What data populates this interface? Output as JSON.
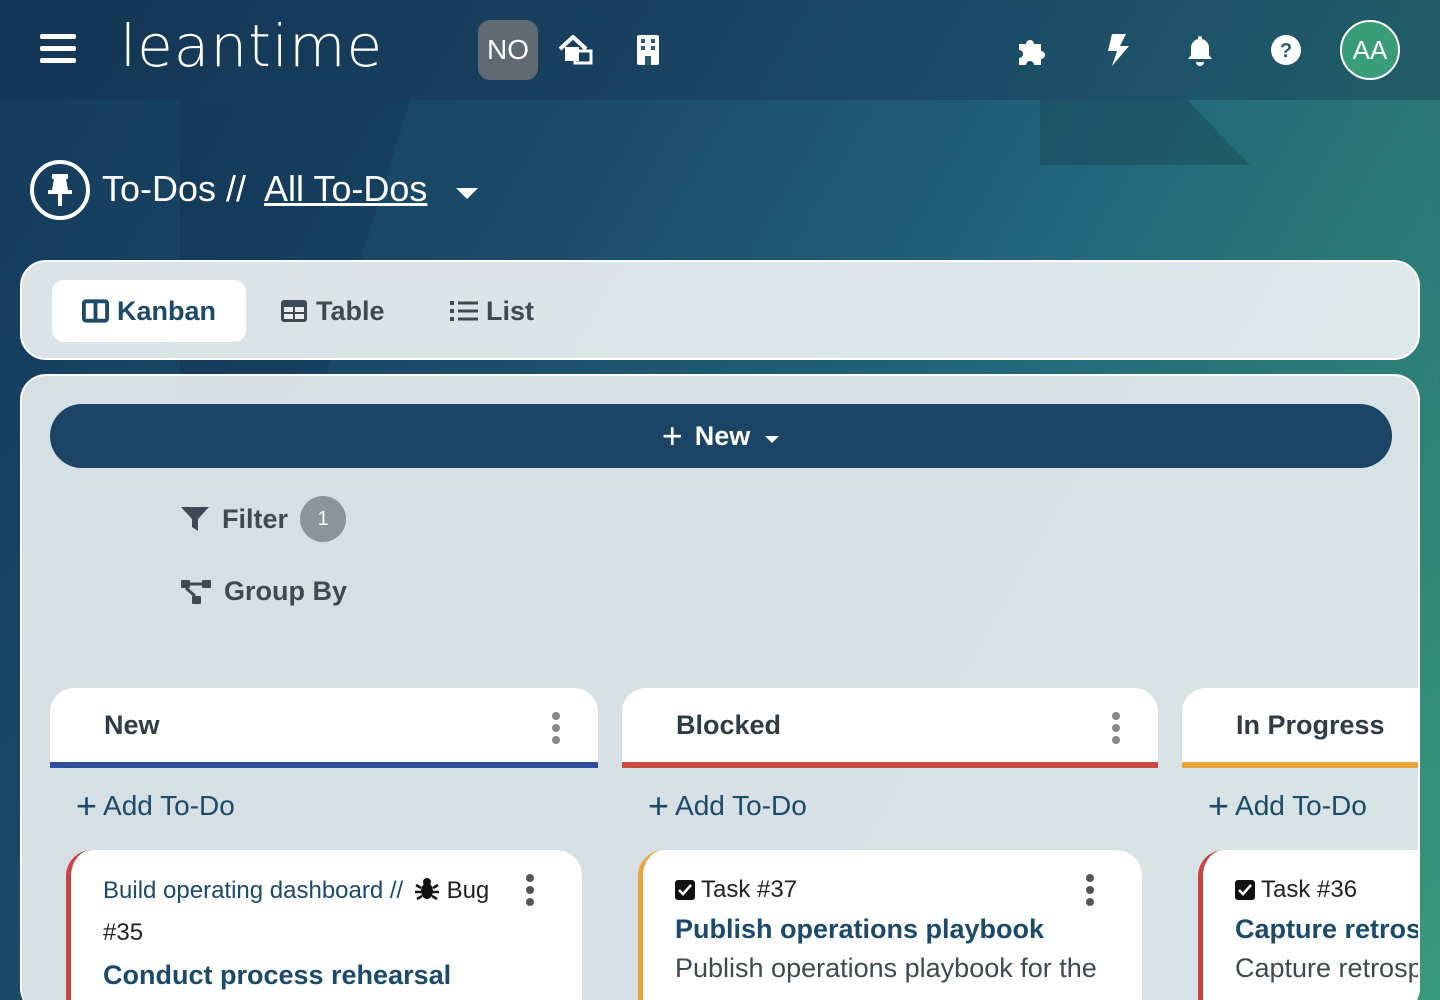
{
  "header": {
    "logo_text": "leantime",
    "company_badge": "NO",
    "avatar_initials": "AA",
    "icons": [
      "menu-icon",
      "home-icon",
      "building-icon",
      "puzzle-icon",
      "bolt-icon",
      "bell-icon",
      "help-icon"
    ]
  },
  "breadcrumb": {
    "section": "To-Dos //",
    "current": "All To-Dos "
  },
  "view_tabs": [
    {
      "label": "Kanban",
      "active": true
    },
    {
      "label": "Table",
      "active": false
    },
    {
      "label": "List",
      "active": false
    }
  ],
  "toolbar": {
    "new_label": "New",
    "filter_label": "Filter",
    "filter_count": "1",
    "group_by_label": "Group By"
  },
  "columns": [
    {
      "title": "New",
      "color": "#2e4d9c",
      "add_label": "Add To-Do",
      "card": {
        "project": "Build operating dashboard //",
        "type_label": "Bug",
        "ticket": "#35",
        "title": "Conduct process rehearsal",
        "accent": "#c74540"
      }
    },
    {
      "title": "Blocked",
      "color": "#c94b45",
      "add_label": "Add To-Do",
      "card": {
        "ticket": "Task #37",
        "title": "Publish operations playbook",
        "description": "Publish operations playbook for the",
        "accent": "#e8a53b"
      }
    },
    {
      "title": "In Progress",
      "color": "#e8a53b",
      "add_label": "Add To-Do",
      "card": {
        "ticket": "Task #36",
        "title": "Capture retrospective",
        "description": "Capture retrospective",
        "accent": "#c74540"
      }
    }
  ]
}
